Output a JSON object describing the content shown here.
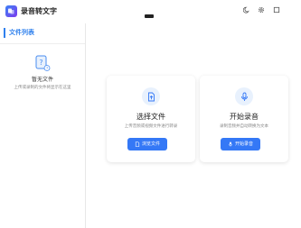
{
  "app": {
    "title": "录音转文字"
  },
  "sidebar": {
    "header": "文件列表",
    "empty_title": "暂无文件",
    "empty_subtitle": "上传或录制的文件将显示在这里"
  },
  "cards": [
    {
      "icon": "upload-file-icon",
      "title": "选择文件",
      "description": "上传音频或视频文件进行转录",
      "button_label": "浏览文件",
      "button_icon": "file-icon"
    },
    {
      "icon": "microphone-icon",
      "title": "开始录音",
      "description": "录制音频并自动转换为文本",
      "button_label": "开始录音",
      "button_icon": "microphone-icon"
    }
  ],
  "window_controls": [
    "moon-icon",
    "gear-icon",
    "window-icon"
  ],
  "colors": {
    "accent": "#3478f6",
    "sidebar_accent": "#2f80ed"
  }
}
